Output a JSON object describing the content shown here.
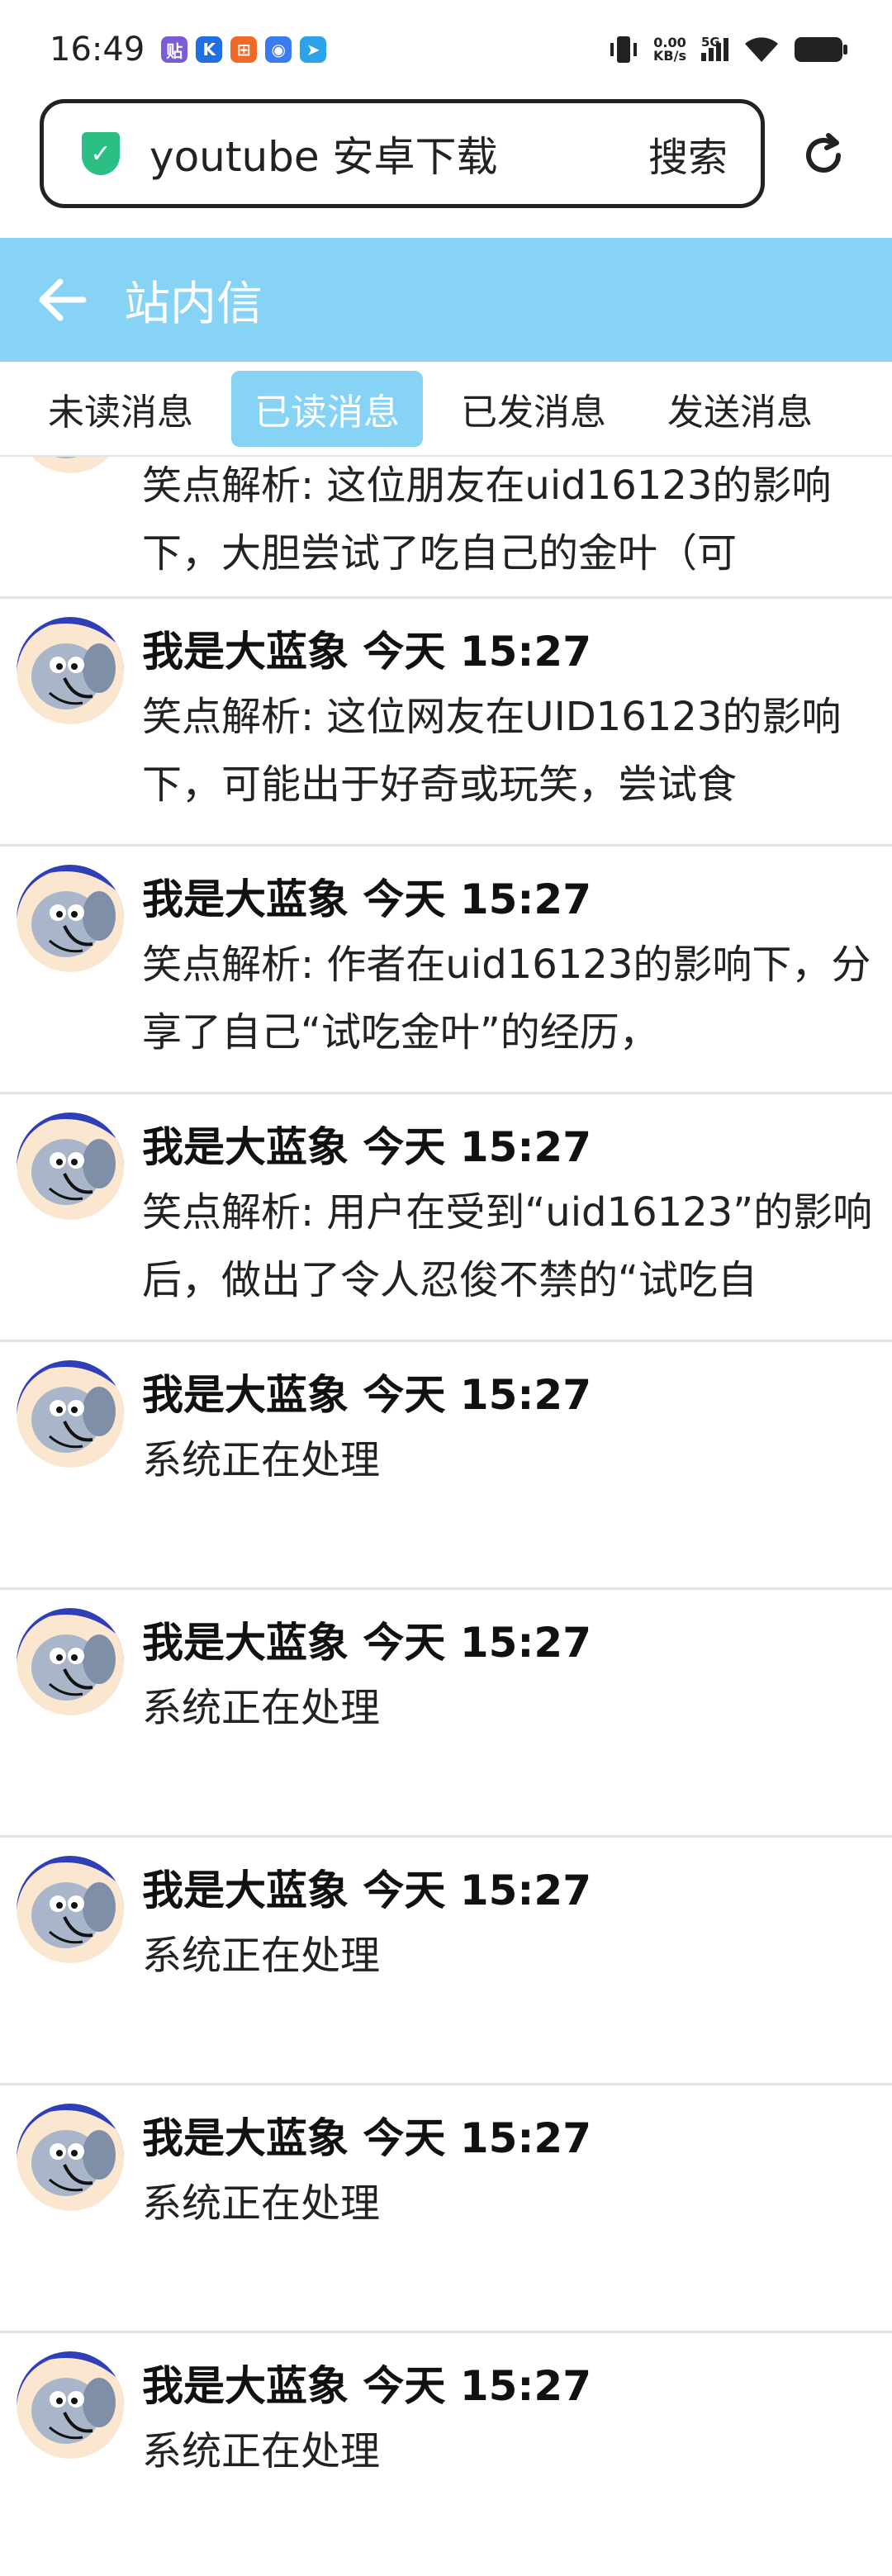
{
  "status_bar": {
    "time": "16:49",
    "net_speed_top": "0.00",
    "net_speed_bottom": "KB/s",
    "network": "5G",
    "notif_icons": [
      "tieba-icon",
      "k-app-icon",
      "orange-app-icon",
      "blue-app-icon",
      "telegram-icon"
    ]
  },
  "browser": {
    "url_text": "youtube 安卓下载",
    "search_label": "搜索"
  },
  "app": {
    "title": "站内信",
    "header_color": "#86d3f5"
  },
  "tabs": [
    {
      "label": "未读消息",
      "active": false
    },
    {
      "label": "已读消息",
      "active": true
    },
    {
      "label": "已发消息",
      "active": false
    },
    {
      "label": "发送消息",
      "active": false
    }
  ],
  "messages": [
    {
      "sender": "",
      "time": "",
      "body": "笑点解析: 这位朋友在uid16123的影响下，大胆尝试了吃自己的金叶（可"
    },
    {
      "sender": "我是大蓝象",
      "time": "今天 15:27",
      "body": "笑点解析: 这位网友在UID16123的影响下，可能出于好奇或玩笑，尝试食"
    },
    {
      "sender": "我是大蓝象",
      "time": "今天 15:27",
      "body": "笑点解析: 作者在uid16123的影响下，分享了自己“试吃金叶”的经历，"
    },
    {
      "sender": "我是大蓝象",
      "time": "今天 15:27",
      "body": "笑点解析: 用户在受到“uid16123”的影响后，做出了令人忍俊不禁的“试吃自"
    },
    {
      "sender": "我是大蓝象",
      "time": "今天 15:27",
      "body": "系统正在处理"
    },
    {
      "sender": "我是大蓝象",
      "time": "今天 15:27",
      "body": "系统正在处理"
    },
    {
      "sender": "我是大蓝象",
      "time": "今天 15:27",
      "body": "系统正在处理"
    },
    {
      "sender": "我是大蓝象",
      "time": "今天 15:27",
      "body": "系统正在处理"
    },
    {
      "sender": "我是大蓝象",
      "time": "今天 15:27",
      "body": "系统正在处理"
    }
  ]
}
